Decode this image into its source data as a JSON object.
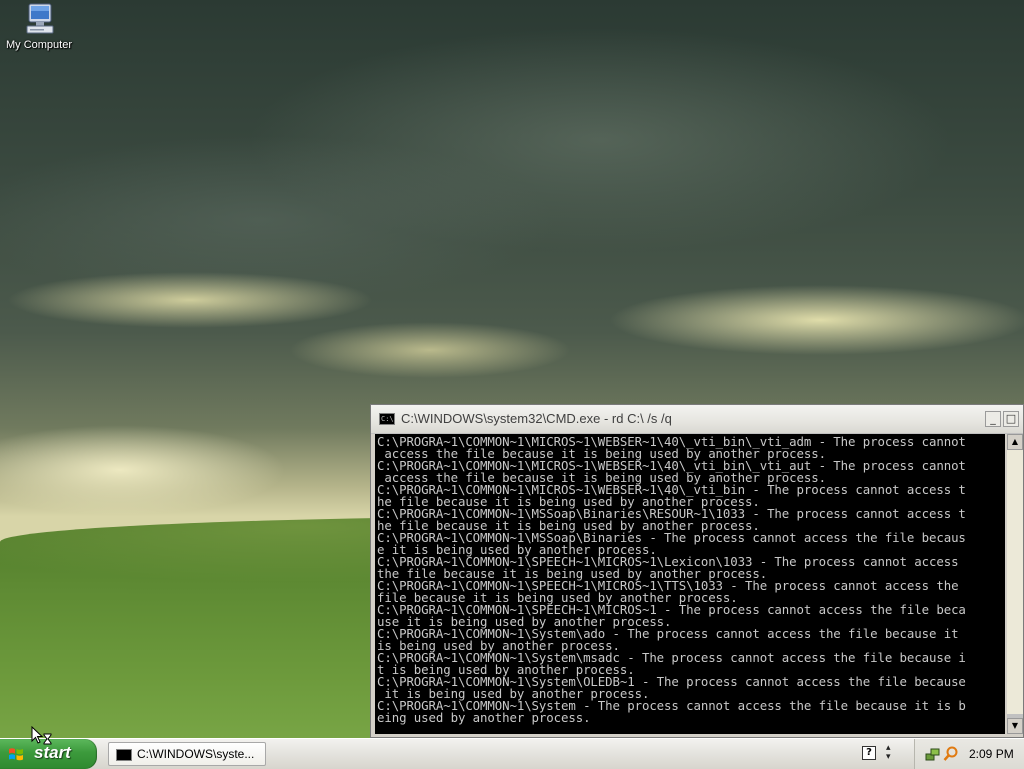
{
  "desktop": {
    "icons": [
      {
        "label": "My Computer",
        "icon": "my-computer-icon"
      }
    ]
  },
  "cmd_window": {
    "title": "C:\\WINDOWS\\system32\\CMD.exe - rd C:\\ /s /q",
    "minimize_label": "_",
    "maximize_label": "□",
    "lines": [
      "C:\\PROGRA~1\\COMMON~1\\MICROS~1\\WEBSER~1\\40\\_vti_bin\\_vti_adm - The process cannot",
      " access the file because it is being used by another process.",
      "C:\\PROGRA~1\\COMMON~1\\MICROS~1\\WEBSER~1\\40\\_vti_bin\\_vti_aut - The process cannot",
      " access the file because it is being used by another process.",
      "C:\\PROGRA~1\\COMMON~1\\MICROS~1\\WEBSER~1\\40\\_vti_bin - The process cannot access t",
      "he file because it is being used by another process.",
      "C:\\PROGRA~1\\COMMON~1\\MSSoap\\Binaries\\RESOUR~1\\1033 - The process cannot access t",
      "he file because it is being used by another process.",
      "C:\\PROGRA~1\\COMMON~1\\MSSoap\\Binaries - The process cannot access the file becaus",
      "e it is being used by another process.",
      "C:\\PROGRA~1\\COMMON~1\\SPEECH~1\\MICROS~1\\Lexicon\\1033 - The process cannot access",
      "the file because it is being used by another process.",
      "C:\\PROGRA~1\\COMMON~1\\SPEECH~1\\MICROS~1\\TTS\\1033 - The process cannot access the",
      "file because it is being used by another process.",
      "C:\\PROGRA~1\\COMMON~1\\SPEECH~1\\MICROS~1 - The process cannot access the file beca",
      "use it is being used by another process.",
      "C:\\PROGRA~1\\COMMON~1\\System\\ado - The process cannot access the file because it",
      "is being used by another process.",
      "C:\\PROGRA~1\\COMMON~1\\System\\msadc - The process cannot access the file because i",
      "t is being used by another process.",
      "C:\\PROGRA~1\\COMMON~1\\System\\OLEDB~1 - The process cannot access the file because",
      " it is being used by another process.",
      "C:\\PROGRA~1\\COMMON~1\\System - The process cannot access the file because it is b",
      "eing used by another process."
    ]
  },
  "taskbar": {
    "start_label": "start",
    "task_item_label": "C:\\WINDOWS\\syste...",
    "clock": "2:09 PM"
  }
}
